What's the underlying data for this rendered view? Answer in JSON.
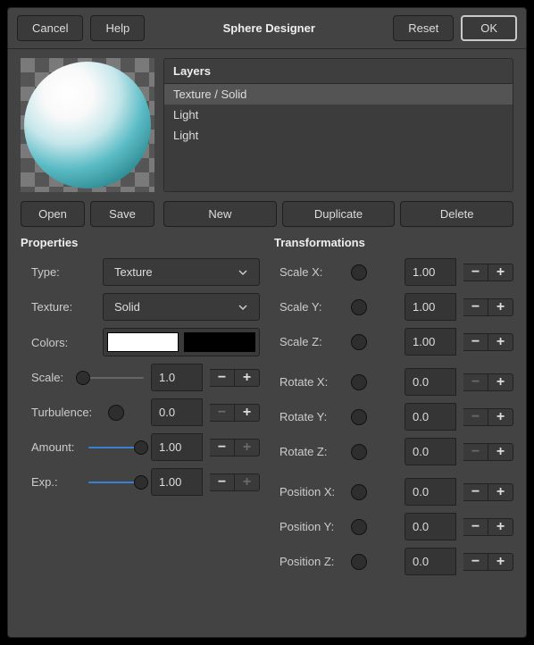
{
  "titlebar": {
    "cancel": "Cancel",
    "help": "Help",
    "title": "Sphere Designer",
    "reset": "Reset",
    "ok": "OK"
  },
  "layers": {
    "header": "Layers",
    "items": [
      {
        "label": "Texture / Solid",
        "selected": true
      },
      {
        "label": "Light",
        "selected": false
      },
      {
        "label": "Light",
        "selected": false
      }
    ]
  },
  "buttons": {
    "open": "Open",
    "save": "Save",
    "new": "New",
    "duplicate": "Duplicate",
    "delete": "Delete"
  },
  "properties": {
    "title": "Properties",
    "type_label": "Type:",
    "type_value": "Texture",
    "texture_label": "Texture:",
    "texture_value": "Solid",
    "colors_label": "Colors:",
    "color1": "#ffffff",
    "color2": "#000000",
    "scale_label": "Scale:",
    "scale_value": "1.0",
    "turbulence_label": "Turbulence:",
    "turbulence_value": "0.0",
    "amount_label": "Amount:",
    "amount_value": "1.00",
    "exp_label": "Exp.:",
    "exp_value": "1.00"
  },
  "transformations": {
    "title": "Transformations",
    "rows": [
      {
        "label": "Scale X:",
        "value": "1.00",
        "dec_disabled": false,
        "inc_disabled": false
      },
      {
        "label": "Scale Y:",
        "value": "1.00",
        "dec_disabled": false,
        "inc_disabled": false
      },
      {
        "label": "Scale Z:",
        "value": "1.00",
        "dec_disabled": false,
        "inc_disabled": false
      },
      {
        "label": "Rotate X:",
        "value": "0.0",
        "dec_disabled": true,
        "inc_disabled": false
      },
      {
        "label": "Rotate Y:",
        "value": "0.0",
        "dec_disabled": true,
        "inc_disabled": false
      },
      {
        "label": "Rotate Z:",
        "value": "0.0",
        "dec_disabled": true,
        "inc_disabled": false
      },
      {
        "label": "Position X:",
        "value": "0.0",
        "dec_disabled": false,
        "inc_disabled": false
      },
      {
        "label": "Position Y:",
        "value": "0.0",
        "dec_disabled": false,
        "inc_disabled": false
      },
      {
        "label": "Position Z:",
        "value": "0.0",
        "dec_disabled": false,
        "inc_disabled": false
      }
    ]
  }
}
